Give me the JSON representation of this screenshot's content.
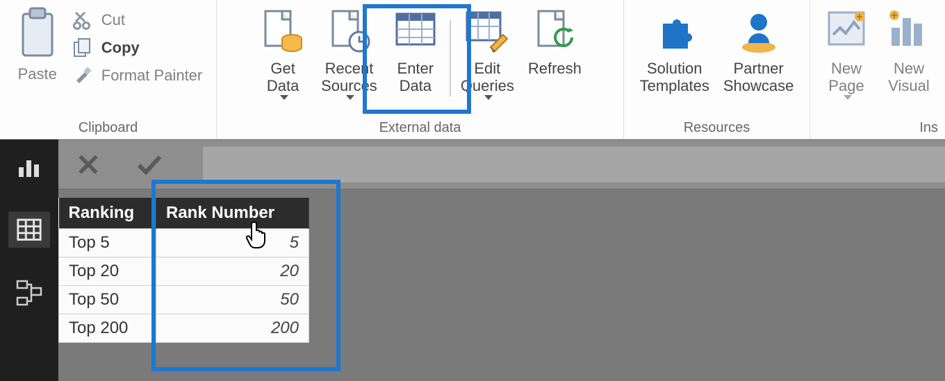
{
  "ribbon": {
    "clipboard": {
      "group_label": "Clipboard",
      "paste": "Paste",
      "cut": "Cut",
      "copy": "Copy",
      "format_painter": "Format Painter"
    },
    "external_data": {
      "group_label": "External data",
      "get_data": "Get\nData",
      "recent_sources": "Recent\nSources",
      "enter_data": "Enter\nData",
      "edit_queries": "Edit\nQueries",
      "refresh": "Refresh"
    },
    "resources": {
      "group_label": "Resources",
      "solution_templates": "Solution\nTemplates",
      "partner_showcase": "Partner\nShowcase"
    },
    "insert": {
      "group_label": "Ins",
      "new_page": "New\nPage",
      "new_visual": "New\nVisual"
    }
  },
  "table": {
    "columns": [
      "Ranking",
      "Rank Number"
    ],
    "rows": [
      {
        "ranking": "Top 5",
        "rank_number": "5"
      },
      {
        "ranking": "Top 20",
        "rank_number": "20"
      },
      {
        "ranking": "Top 50",
        "rank_number": "50"
      },
      {
        "ranking": "Top 200",
        "rank_number": "200"
      }
    ]
  },
  "icons": {
    "clipboard": "clipboard-icon",
    "scissors": "scissors-icon",
    "copy": "copy-icon",
    "brush": "brush-icon"
  }
}
